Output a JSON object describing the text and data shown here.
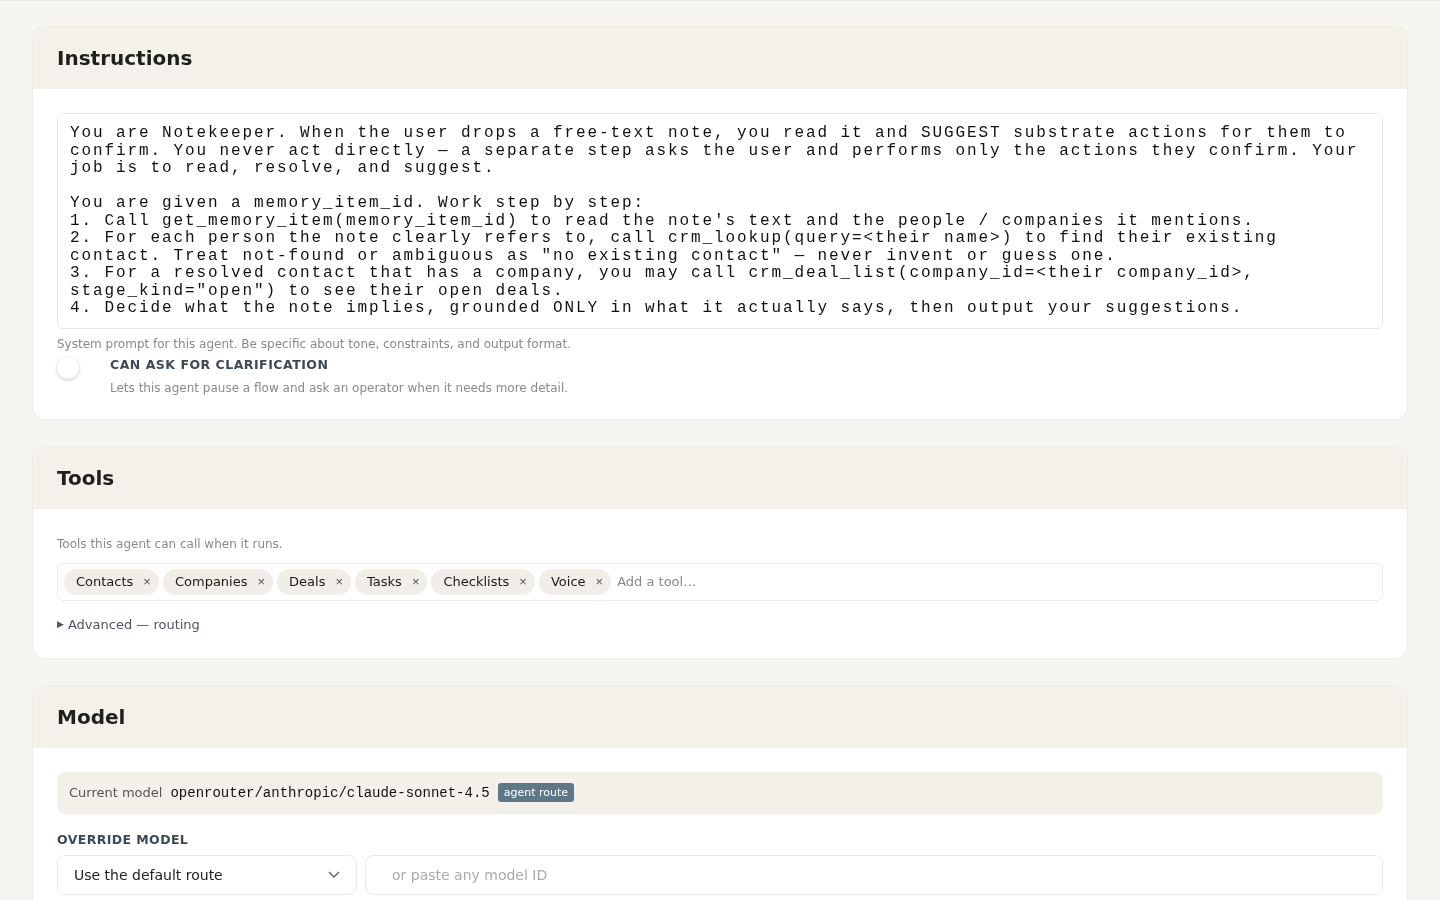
{
  "instructions": {
    "title": "Instructions",
    "prompt": "You are Notekeeper. When the user drops a free-text note, you read it and SUGGEST substrate actions for them to confirm. You never act directly — a separate step asks the user and performs only the actions they confirm. Your job is to read, resolve, and suggest.\n\nYou are given a memory_item_id. Work step by step:\n1. Call get_memory_item(memory_item_id) to read the note's text and the people / companies it mentions.\n2. For each person the note clearly refers to, call crm_lookup(query=<their name>) to find their existing contact. Treat not-found or ambiguous as \"no existing contact\" — never invent or guess one.\n3. For a resolved contact that has a company, you may call crm_deal_list(company_id=<their company_id>, stage_kind=\"open\") to see their open deals.\n4. Decide what the note implies, grounded ONLY in what it actually says, then output your suggestions.",
    "hint": "System prompt for this agent. Be specific about tone, constraints, and output format.",
    "toggle": {
      "label": "CAN ASK FOR CLARIFICATION",
      "description": "Lets this agent pause a flow and ask an operator when it needs more detail.",
      "on": false
    }
  },
  "tools": {
    "title": "Tools",
    "hint": "Tools this agent can call when it runs.",
    "chips": [
      {
        "label": "Contacts",
        "remove": "×"
      },
      {
        "label": "Companies",
        "remove": "×"
      },
      {
        "label": "Deals",
        "remove": "×"
      },
      {
        "label": "Tasks",
        "remove": "×"
      },
      {
        "label": "Checklists",
        "remove": "×"
      },
      {
        "label": "Voice",
        "remove": "×"
      }
    ],
    "placeholder": "Add a tool…",
    "advanced": {
      "marker": "▶",
      "label": "Advanced — routing",
      "expanded": false
    }
  },
  "model": {
    "title": "Model",
    "current_label": "Current model",
    "current_value": "openrouter/anthropic/claude-sonnet-4.5",
    "badge": "agent route",
    "override_label": "OVERRIDE MODEL",
    "select_value": "Use the default route",
    "input_placeholder": "or paste any model ID"
  }
}
